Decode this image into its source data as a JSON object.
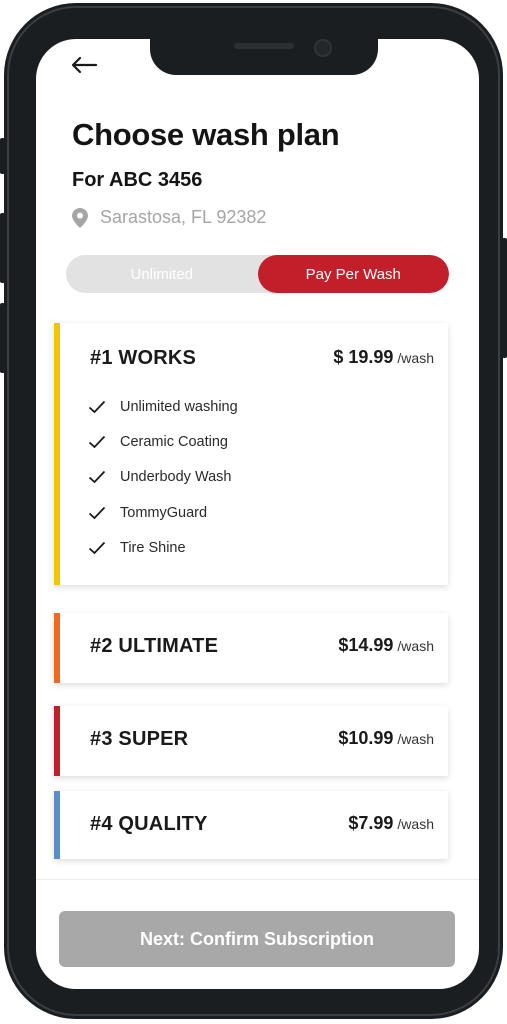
{
  "header": {
    "back_icon": "arrow-left-icon",
    "title": "Choose wash plan",
    "subtitle": "For ABC 3456",
    "location_icon": "map-pin-icon",
    "location": "Sarastosa, FL 92382"
  },
  "toggle": {
    "options": [
      "Unlimited",
      "Pay Per Wash"
    ],
    "selected": "Pay Per Wash",
    "selected_color": "#c21f2a"
  },
  "plans": [
    {
      "name": "#1 WORKS",
      "price": "$ 19.99",
      "unit": "/wash",
      "accent": "#f5c400",
      "expanded": true,
      "features": [
        "Unlimited washing",
        "Ceramic Coating",
        "Underbody Wash",
        "TommyGuard",
        "Tire Shine"
      ]
    },
    {
      "name": "#2 ULTIMATE",
      "price": "$14.99",
      "unit": "/wash",
      "accent": "#ee6a1f"
    },
    {
      "name": "#3 SUPER",
      "price": "$10.99",
      "unit": "/wash",
      "accent": "#c21f2a"
    },
    {
      "name": "#4 QUALITY",
      "price": "$7.99",
      "unit": "/wash",
      "accent": "#5b8ec9"
    }
  ],
  "footer": {
    "cta_label": "Next: Confirm Subscription"
  }
}
